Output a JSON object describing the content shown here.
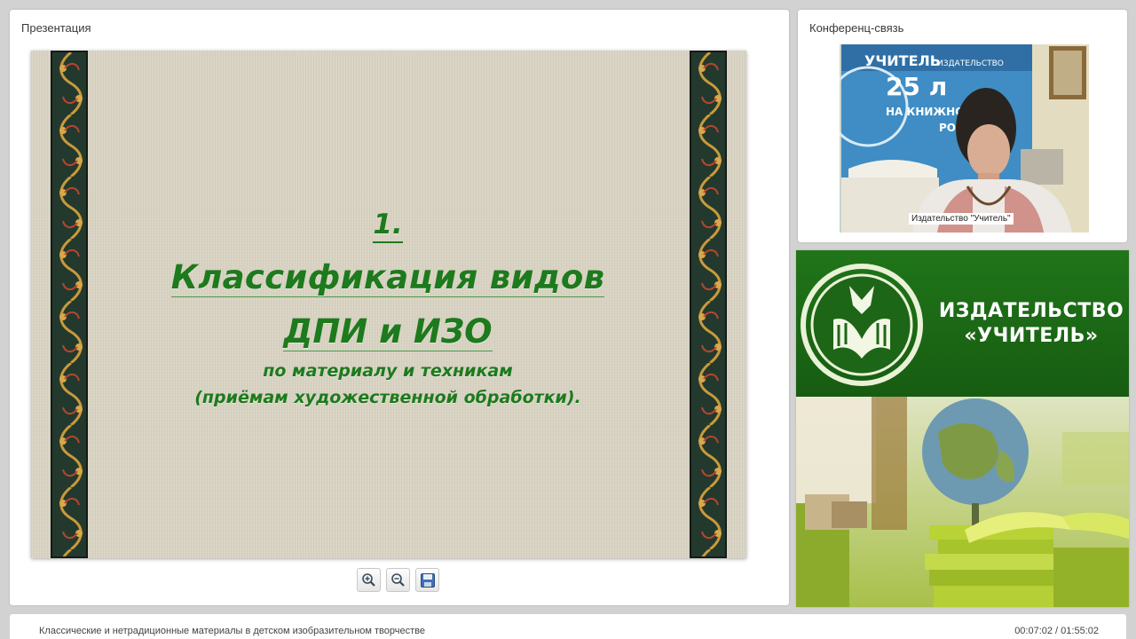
{
  "presentation": {
    "panel_title": "Презентация",
    "slide": {
      "number": "1.",
      "title_line1": "Классификация видов",
      "title_line2": "ДПИ и ИЗО",
      "subtitle_line1": "по материалу и техникам",
      "subtitle_line2": "(приёмам художественной обработки).",
      "text_color": "#1d7a1d",
      "background_color": "#d9d3c3"
    },
    "toolbar": [
      {
        "name": "zoom-in",
        "icon": "zoom-in-icon"
      },
      {
        "name": "zoom-out",
        "icon": "zoom-out-icon"
      },
      {
        "name": "save",
        "icon": "save-icon"
      }
    ]
  },
  "conference": {
    "panel_title": "Конференц-связь",
    "video": {
      "caption": "Издательство \"Учитель\"",
      "banner_number": "25 л",
      "banner_lines": [
        "УЧИТЕЛЬ",
        "ИЗДАТЕЛЬСТВО",
        "НА КНИЖНОМ",
        "РО"
      ]
    }
  },
  "publisher": {
    "name_line1": "ИЗДАТЕЛЬСТВО",
    "name_line2": "«УЧИТЕЛЬ»",
    "brand_color": "#1f6e1a"
  },
  "footer": {
    "course_title": "Классические и нетрадиционные материалы в детском изобразительном творчестве",
    "time": "00:07:02 / 01:55:02"
  }
}
